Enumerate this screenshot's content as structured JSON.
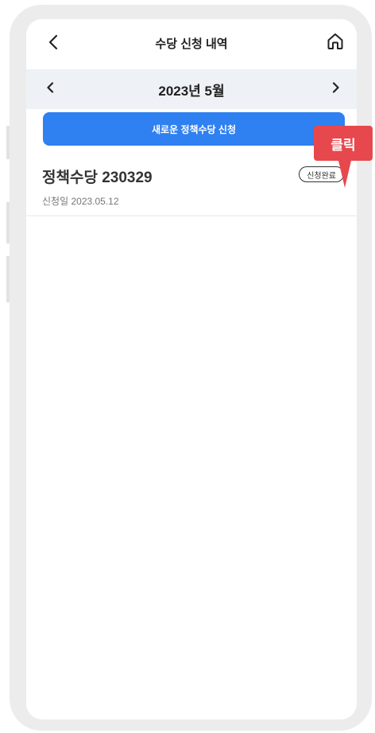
{
  "header": {
    "back_icon": "chevron-left-icon",
    "title": "수당 신청 내역",
    "home_icon": "home-icon"
  },
  "month_nav": {
    "prev_icon": "chevron-left-icon",
    "label": "2023년 5월",
    "next_icon": "chevron-right-icon"
  },
  "new_application_button": "새로운 정책수당 신청",
  "applications": [
    {
      "title": "정책수당 230329",
      "date_label": "신청일",
      "date": "2023.05.12",
      "status": "신청완료"
    }
  ],
  "callout": {
    "label": "클릭",
    "color": "#e7484e"
  },
  "colors": {
    "accent": "#2f80f0",
    "month_bar_bg": "#eef1f5",
    "frame": "#ececec"
  }
}
